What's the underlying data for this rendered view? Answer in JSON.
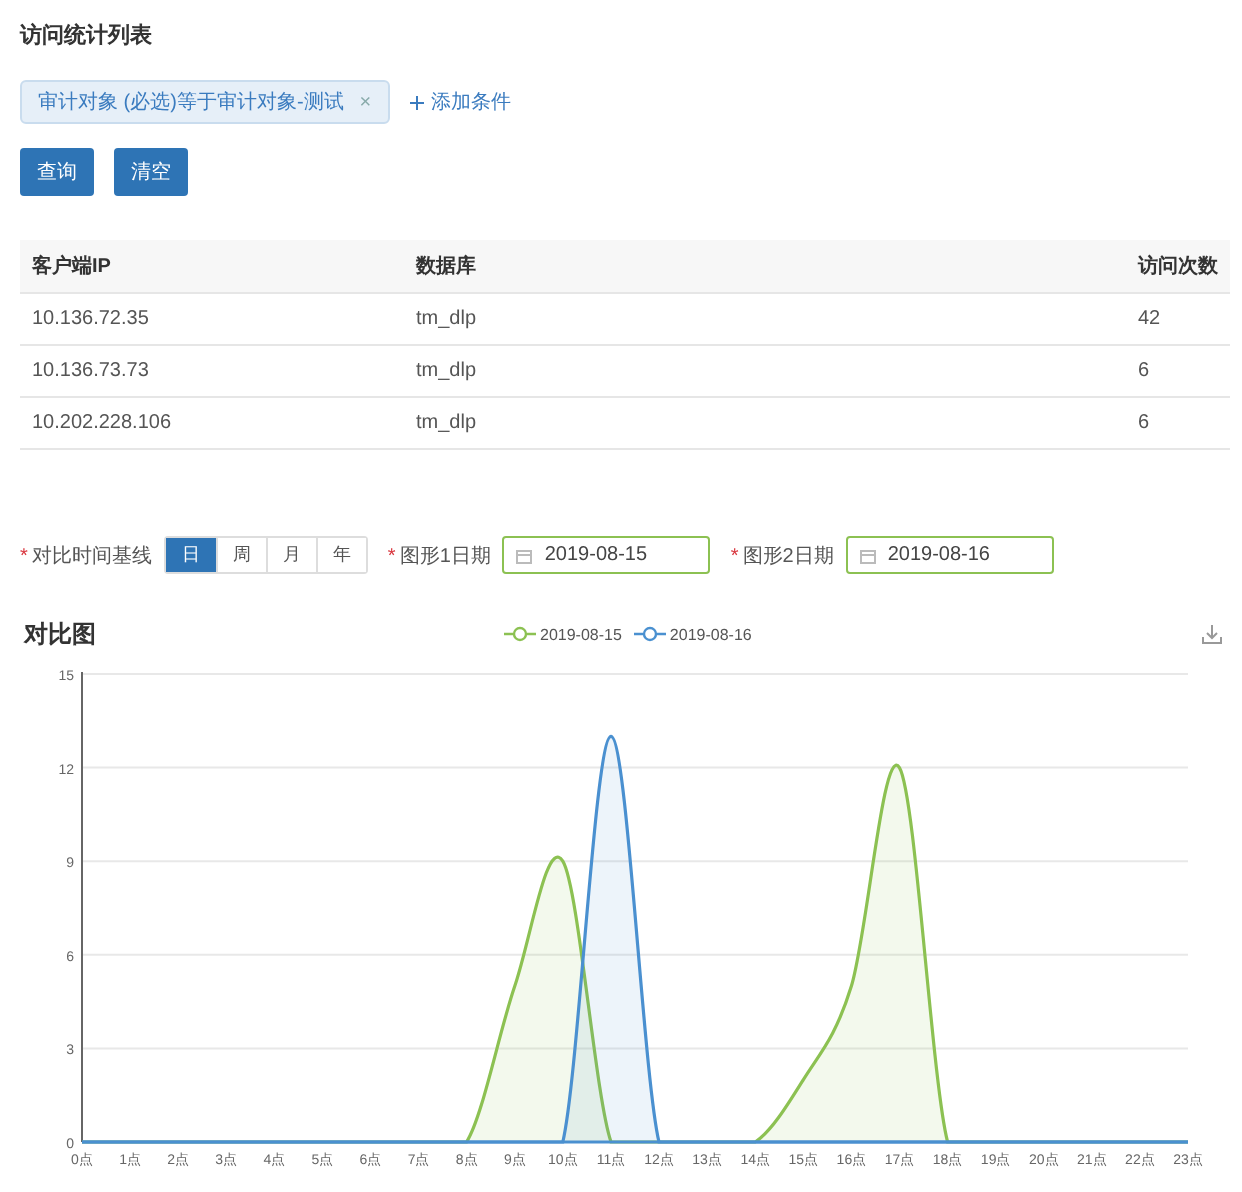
{
  "page_title": "访问统计列表",
  "filter": {
    "chips": [
      {
        "label": "审计对象 (必选)等于审计对象-测试",
        "remove": "×"
      }
    ],
    "add_condition": "添加条件"
  },
  "buttons": [
    {
      "label": "查询"
    },
    {
      "label": "清空"
    }
  ],
  "table": {
    "columns": [
      "客户端IP",
      "数据库",
      "访问次数"
    ],
    "rows": [
      [
        "10.136.72.35",
        "tm_dlp",
        "42"
      ],
      [
        "10.136.73.73",
        "tm_dlp",
        "6"
      ],
      [
        "10.202.228.106",
        "tm_dlp",
        "6"
      ]
    ]
  },
  "compare": {
    "baseline": {
      "mark": "*",
      "label": "对比时间基线",
      "periods": [
        {
          "label": "日",
          "selected": true
        },
        {
          "label": "周",
          "selected": false
        },
        {
          "label": "月",
          "selected": false
        },
        {
          "label": "年",
          "selected": false
        }
      ]
    },
    "dates": [
      {
        "mark": "*",
        "label": "图形1日期",
        "value": "2019-08-15"
      },
      {
        "mark": "*",
        "label": "图形2日期",
        "value": "2019-08-16"
      }
    ]
  },
  "chart": {
    "title": "对比图",
    "chart_data": {
      "type": "area",
      "grid": true,
      "categories": [
        "0点",
        "1点",
        "2点",
        "3点",
        "4点",
        "5点",
        "6点",
        "7点",
        "8点",
        "9点",
        "10点",
        "11点",
        "12点",
        "13点",
        "14点",
        "15点",
        "16点",
        "17点",
        "18点",
        "19点",
        "20点",
        "21点",
        "22点",
        "23点"
      ],
      "ylim": [
        0,
        15
      ],
      "yticks": [
        0,
        3,
        6,
        9,
        12,
        15
      ],
      "series": [
        {
          "name": "2019-08-15",
          "color": "#8cc152",
          "values": [
            0,
            0,
            0,
            0,
            0,
            0,
            0,
            0,
            0,
            5,
            9,
            0,
            0,
            0,
            0,
            2,
            5,
            12,
            0,
            0,
            0,
            0,
            0,
            0
          ]
        },
        {
          "name": "2019-08-16",
          "color": "#4a90d0",
          "values": [
            0,
            0,
            0,
            0,
            0,
            0,
            0,
            0,
            0,
            0,
            0,
            13,
            0,
            0,
            0,
            0,
            0,
            0,
            0,
            0,
            0,
            0,
            0,
            0
          ]
        }
      ]
    }
  }
}
